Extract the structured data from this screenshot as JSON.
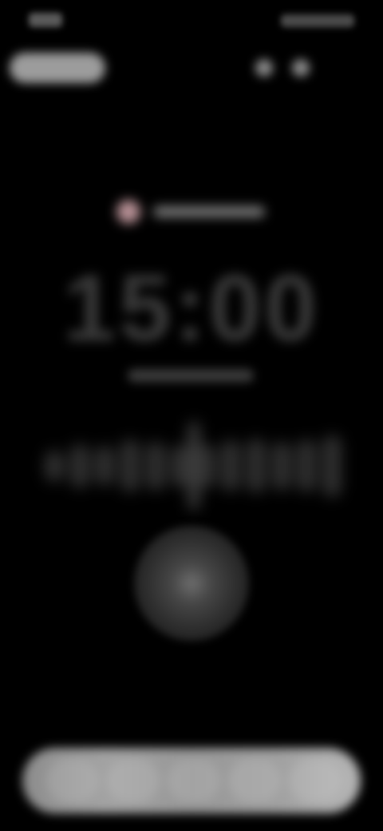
{
  "timer": {
    "text": "15:00"
  },
  "recording": {
    "indicator_color": "#b58f94"
  },
  "colors": {
    "background": "#000000"
  },
  "waveform": {
    "levels": [
      0.35,
      0.5,
      0.45,
      0.6,
      0.55,
      0.48,
      0.5,
      0.58,
      0.62,
      0.55,
      0.6,
      0.7
    ]
  },
  "icons": {
    "record_indicator": "record-dot-icon",
    "main_control": "play-icon"
  }
}
